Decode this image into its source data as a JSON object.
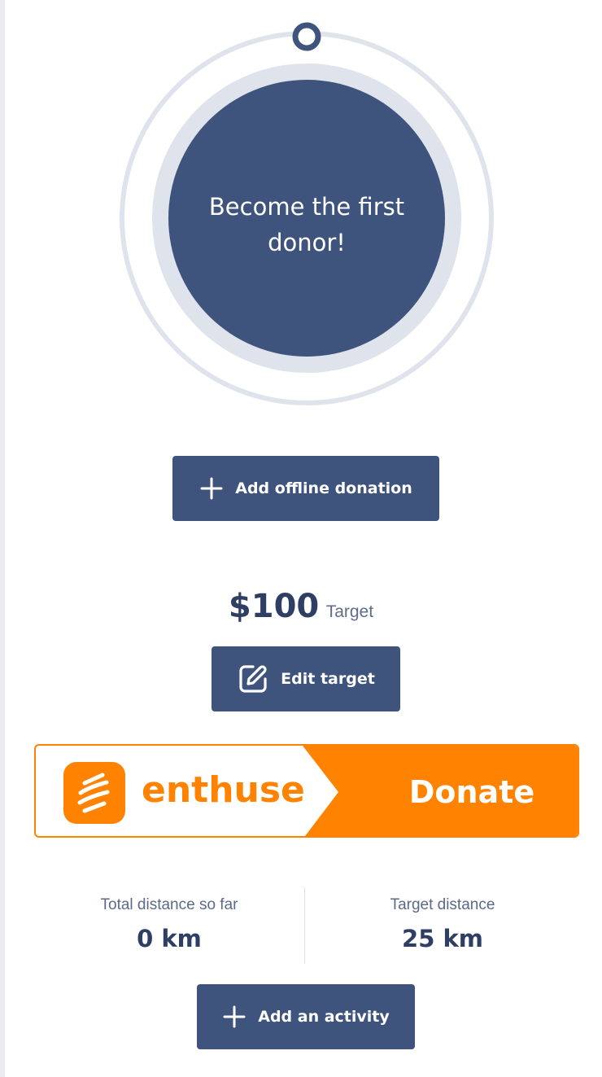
{
  "progress": {
    "message": "Become the first donor!",
    "fraction": 0
  },
  "offline_donation": {
    "label": "Add offline donation",
    "icon": "plus-icon"
  },
  "target": {
    "amount": "$100",
    "caption": "Target",
    "edit_label": "Edit target",
    "edit_icon": "edit-icon"
  },
  "donate_banner": {
    "brand": "enthuse",
    "label": "Donate",
    "logo_icon": "enthuse-logo-icon"
  },
  "stats": {
    "total_label": "Total distance so far",
    "total_value": "0 km",
    "target_label": "Target distance",
    "target_value": "25 km"
  },
  "activity": {
    "label": "Add an activity",
    "icon": "plus-icon"
  },
  "colors": {
    "primary": "#3f547c",
    "ring_track": "#dfe3ec",
    "brand_orange": "#ff8200"
  }
}
